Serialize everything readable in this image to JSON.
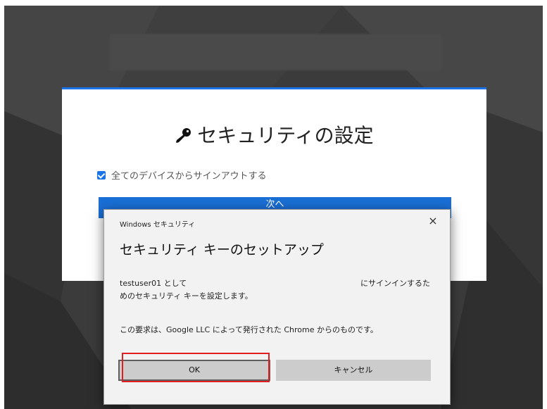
{
  "card": {
    "title": "セキュリティの設定",
    "checkbox_label": "全てのデバイスからサインアウトする",
    "checkbox_checked": true,
    "next_button": "次へ",
    "accent_color": "#1a73e8"
  },
  "dialog": {
    "caption": "Windows セキュリティ",
    "heading": "セキュリティ キーのセットアップ",
    "message_part1": "testuser01 として",
    "message_part2": "にサインインするた",
    "message_line2": "めのセキュリティ キーを設定します。",
    "message_line3": "この要求は、Google LLC によって発行された Chrome からのものです。",
    "ok_button": "OK",
    "cancel_button": "キャンセル",
    "close_icon": "×"
  }
}
